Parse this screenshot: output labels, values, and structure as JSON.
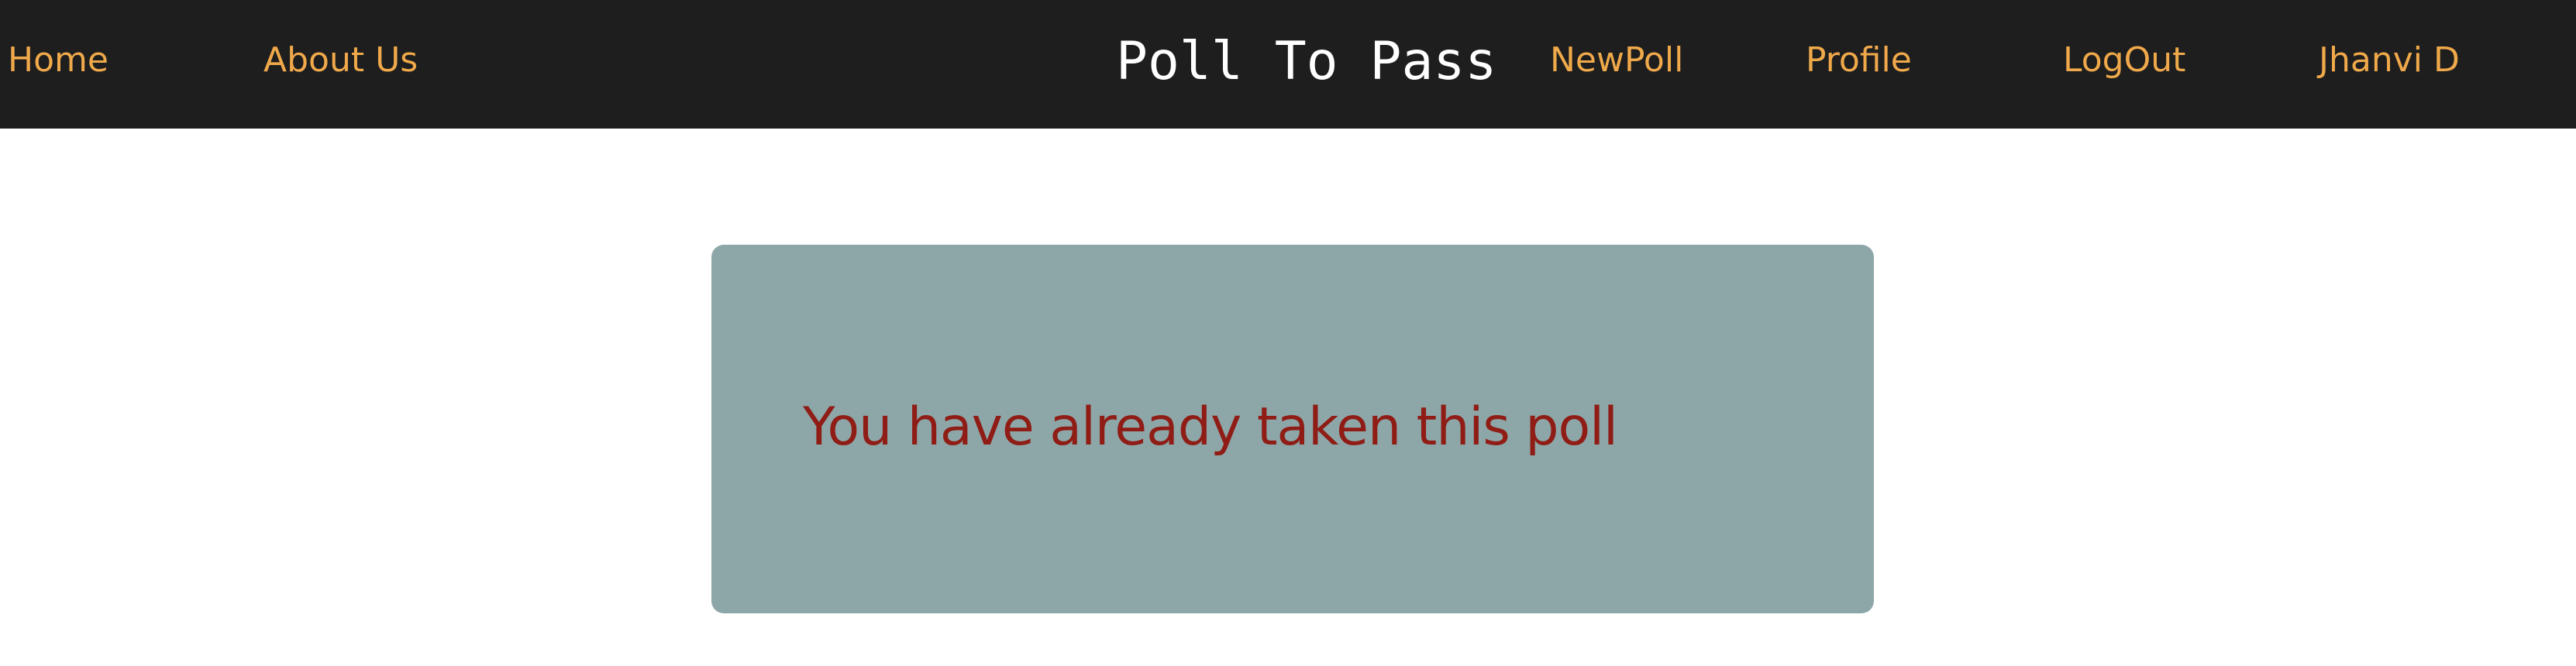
{
  "nav": {
    "home": "Home",
    "about": "About Us",
    "brand": "Poll To Pass",
    "new_poll": "NewPoll",
    "profile": "Profile",
    "logout": "LogOut",
    "user": "Jhanvi D"
  },
  "main": {
    "message": "You have already taken this poll"
  },
  "colors": {
    "navbar_bg": "#1e1e1e",
    "nav_link": "#f0a94a",
    "brand_text": "#ffffff",
    "card_bg": "#8da7a8",
    "message_text": "#8f1d16"
  }
}
